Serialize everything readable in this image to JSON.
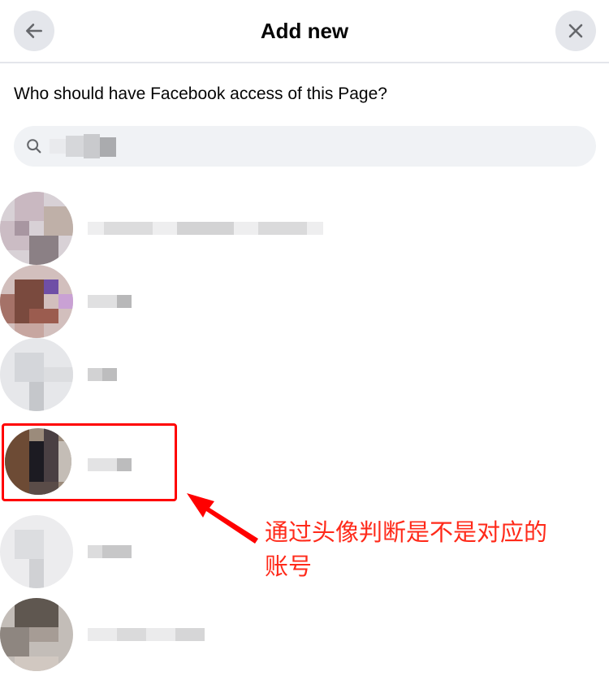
{
  "header": {
    "title": "Add new",
    "back_icon": "arrow-left-icon",
    "close_icon": "close-icon"
  },
  "question": "Who should have Facebook access of this Page?",
  "search": {
    "icon": "search-icon",
    "value": "",
    "placeholder": ""
  },
  "people": [
    {
      "avatar": "blurred",
      "name": "",
      "highlighted": false
    },
    {
      "avatar": "blurred",
      "name": "",
      "highlighted": false
    },
    {
      "avatar": "blurred",
      "name": "",
      "highlighted": false
    },
    {
      "avatar": "blurred",
      "name": "",
      "highlighted": true
    },
    {
      "avatar": "blurred",
      "name": "",
      "highlighted": false
    },
    {
      "avatar": "blurred",
      "name": "",
      "highlighted": false
    }
  ],
  "annotation": {
    "text_line1": "通过头像判断是不是对应的",
    "text_line2": "账号",
    "color": "#ff0000"
  },
  "colors": {
    "button_bg": "#e4e6eb",
    "search_bg": "#f0f2f5",
    "divider": "#e4e6eb"
  }
}
